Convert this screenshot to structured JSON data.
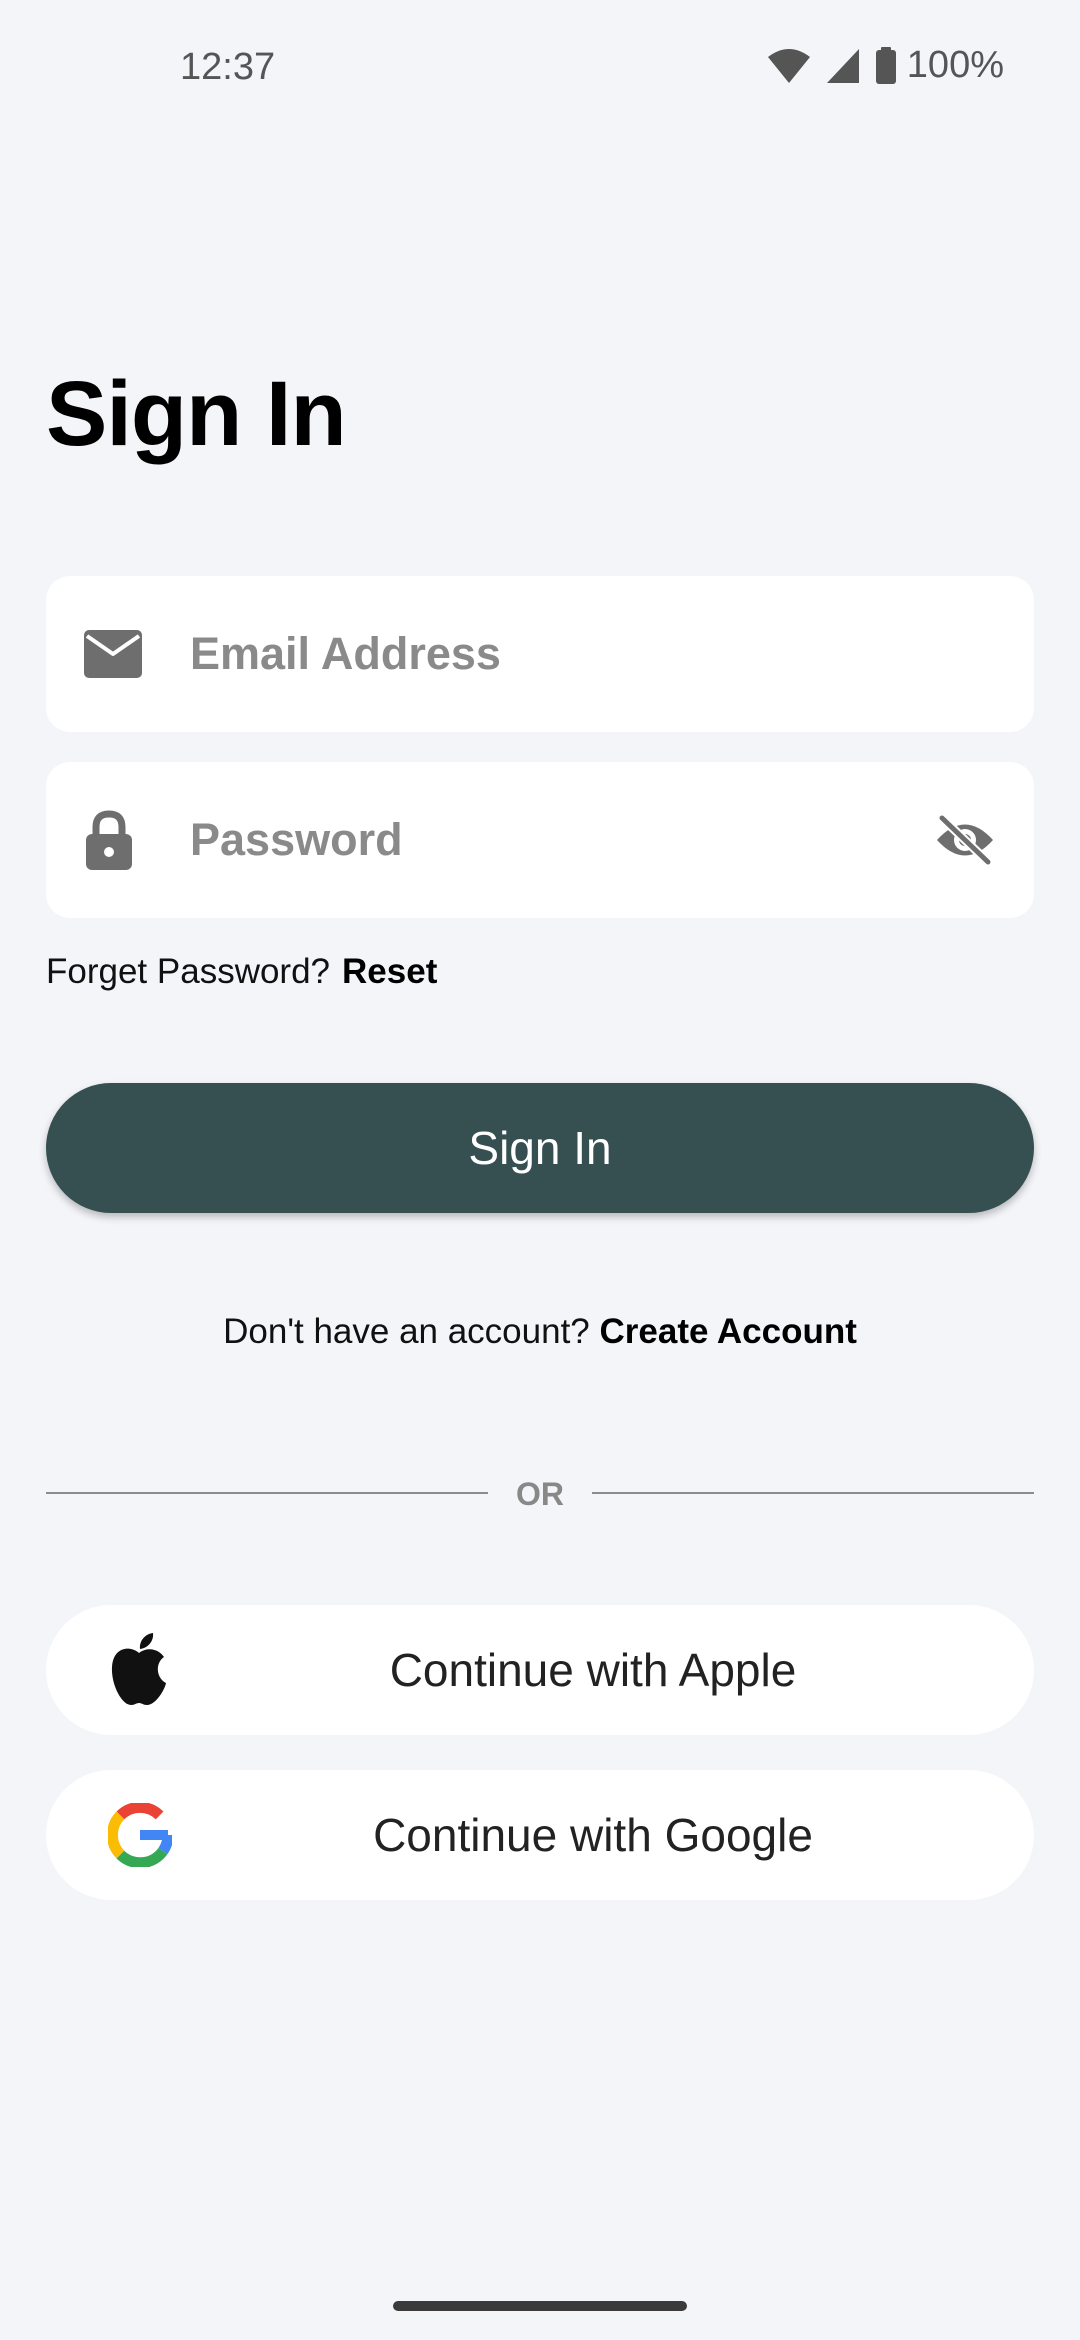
{
  "status_bar": {
    "time": "12:37",
    "battery": "100%",
    "icons": [
      "wifi-icon",
      "cellular-signal-icon",
      "battery-icon"
    ]
  },
  "title": "Sign In",
  "email": {
    "placeholder": "Email Address",
    "value": "",
    "icon": "mail-icon"
  },
  "password": {
    "placeholder": "Password",
    "value": "",
    "icon": "lock-icon",
    "toggle_icon": "visibility-off-icon"
  },
  "forgot": {
    "prompt": "Forget Password?",
    "link": "Reset"
  },
  "sign_in_button": "Sign In",
  "create_account": {
    "prompt": "Don't have an account?",
    "link": "Create Account"
  },
  "divider": "OR",
  "social": {
    "apple_label": "Continue with Apple",
    "google_label": "Continue with Google"
  },
  "colors": {
    "background": "#F4F5F9",
    "primary_button": "#365052",
    "field_background": "#FFFFFF",
    "placeholder": "#8A8A8A"
  }
}
